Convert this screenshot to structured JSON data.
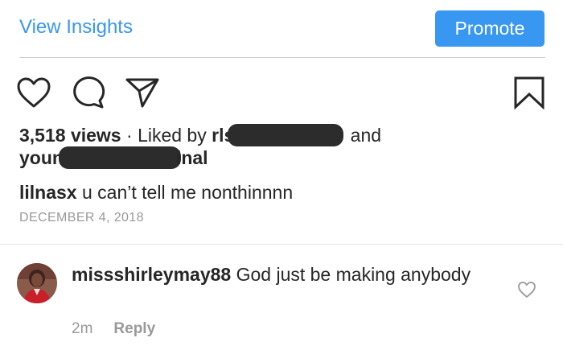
{
  "header": {
    "insights_label": "View Insights",
    "promote_label": "Promote"
  },
  "actions": {
    "icons": [
      "heart-icon",
      "comment-icon",
      "share-icon",
      "bookmark-icon"
    ]
  },
  "post": {
    "views": "3,518 views",
    "separator": "·",
    "liked_by_prefix": "Liked by",
    "liker1_visible": "rls",
    "and_word": "and",
    "liker2_visible_start": "youn",
    "liker2_visible_end": "inal",
    "caption_username": "lilnasx",
    "caption_text": "u can’t tell me nonthinnnn",
    "date": "DECEMBER 4, 2018"
  },
  "comment": {
    "username": "missshirleymay88",
    "text": "God just be making anybody",
    "time": "2m",
    "reply_label": "Reply"
  },
  "colors": {
    "accent": "#3897f0",
    "text": "#262626",
    "muted": "#999999",
    "redaction": "#2c2c2c"
  }
}
